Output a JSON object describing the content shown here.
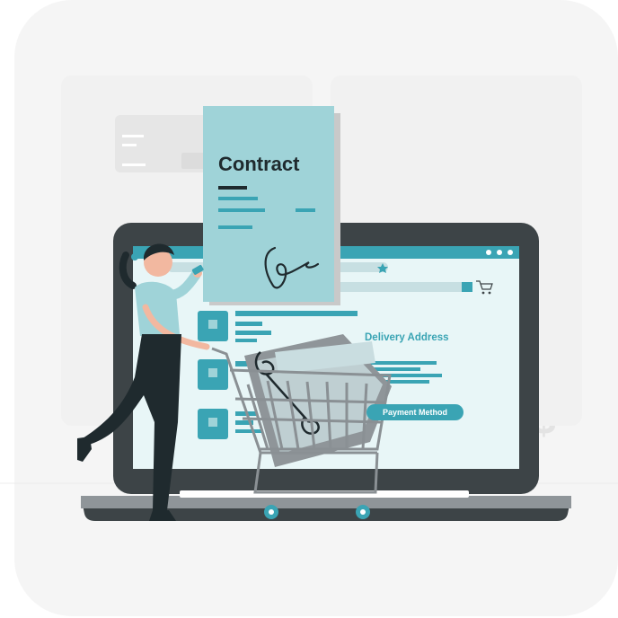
{
  "illustration": {
    "contract_title": "Contract",
    "delivery_label": "Delivery Address",
    "payment_button_label": "Payment Method",
    "currency_symbol": "$",
    "percent_symbol": "%"
  },
  "colors": {
    "teal": "#3aa4b4",
    "light_teal": "#9fd3d8",
    "laptop_body": "#3d4447",
    "screen_bg": "#e8f6f7",
    "character_dark": "#1f2a2e"
  }
}
